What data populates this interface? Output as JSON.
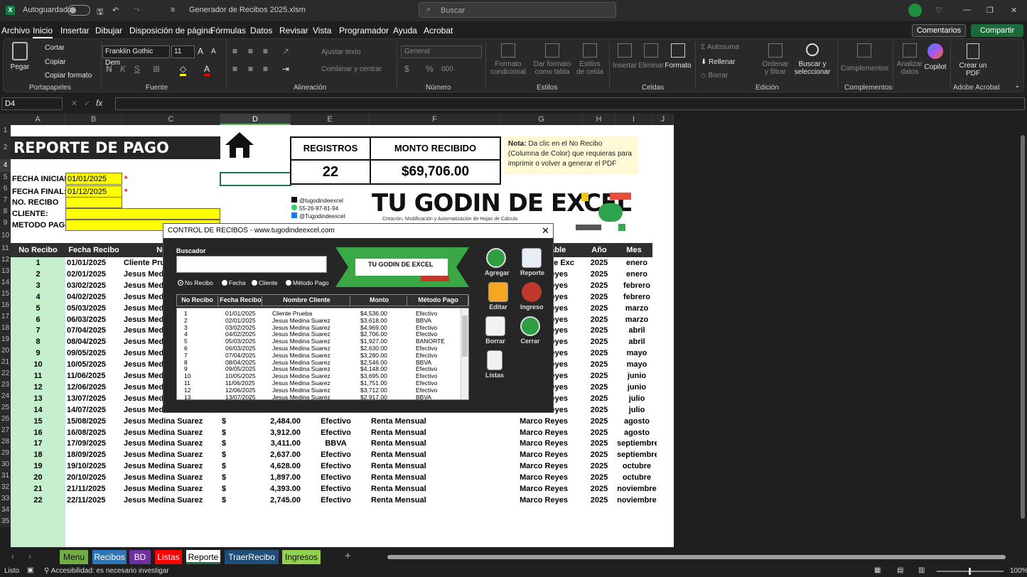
{
  "titlebar": {
    "autosave": "Autoguardado",
    "filename": "Generador de Recibos 2025.xlsm",
    "search": "Buscar"
  },
  "menu": [
    "Archivo",
    "Inicio",
    "Insertar",
    "Dibujar",
    "Disposición de página",
    "Fórmulas",
    "Datos",
    "Revisar",
    "Vista",
    "Programador",
    "Ayuda",
    "Acrobat"
  ],
  "menu_right": {
    "comments": "Comentarios",
    "share": "Compartir"
  },
  "ribbon": {
    "pegar": "Pegar",
    "cortar": "Cortar",
    "copiar": "Copiar",
    "copiar_formato": "Copiar formato",
    "font": "Franklin Gothic Dem",
    "size": "11",
    "ajustar": "Ajustar texto",
    "combinar": "Combinar y centrar",
    "numformat": "General",
    "formato_cond": "Formato condicional",
    "dar_formato": "Dar formato como tabla",
    "estilos_celda": "Estilos de celda",
    "insertar": "Insertar",
    "eliminar": "Eliminar",
    "formato": "Formato",
    "autosuma": "Autosuma",
    "rellenar": "Rellenar",
    "borrar": "Borrar",
    "ordenar": "Ordenar y filtrar",
    "buscar": "Buscar y seleccionar",
    "complementos": "Complementos",
    "analizar": "Analizar datos",
    "copilot": "Copilot",
    "crear_pdf": "Crear un PDF",
    "groups": {
      "portapapeles": "Portapapeles",
      "fuente": "Fuente",
      "alineacion": "Alineación",
      "numero": "Número",
      "estilos": "Estilos",
      "celdas": "Celdas",
      "edicion": "Edición",
      "complementos": "Complementos",
      "acrobat": "Adobe Acrobat"
    }
  },
  "namebox": "D4",
  "fx": "fx",
  "columns": [
    "A",
    "B",
    "C",
    "D",
    "E",
    "F",
    "G",
    "H",
    "I",
    "J"
  ],
  "rows": [
    "1",
    "2",
    "3",
    "4",
    "5",
    "6",
    "7",
    "8",
    "9",
    "10",
    "11",
    "12",
    "13",
    "14",
    "15",
    "16",
    "17",
    "18",
    "19",
    "20",
    "21",
    "22",
    "23",
    "24",
    "25",
    "26",
    "27",
    "28",
    "29",
    "30",
    "31",
    "32",
    "33",
    "34",
    "35"
  ],
  "report": {
    "title": "REPORTE DE PAGO",
    "fecha_inicial_label": "FECHA INICIAL:",
    "fecha_inicial": "01/01/2025",
    "fecha_final_label": "FECHA FINAL:",
    "fecha_final": "01/12/2025",
    "no_recibo_label": "NO. RECIBO",
    "cliente_label": "CLIENTE:",
    "metodo_label": "METODO PAGO:",
    "asterisk": "*",
    "registros_label": "REGISTROS",
    "registros": "22",
    "monto_label": "MONTO RECIBIDO",
    "monto": "$69,706.00",
    "nota_bold": "Nota:",
    "nota": "Da clic en el No Recibo (Columna de Color) que requieras para imprimir o volver a generar el PDF",
    "social": [
      "@tugodindeexcel",
      "55-26-97-81-94",
      "@Tugodindeexcel"
    ],
    "brand": "TU GODIN DE EXCEL",
    "brand_sub": "Creación, Modificación y Automatización de Hojas de Cálculo"
  },
  "table_headers": [
    "No Recibo",
    "Fecha Recibo",
    "Nombre",
    "",
    "",
    "",
    "Responsable",
    "Año",
    "Mes"
  ],
  "table_rows": [
    [
      "1",
      "01/01/2025",
      "Cliente Prueba",
      "",
      "",
      "",
      "Tu Godin de Excel",
      "2025",
      "enero"
    ],
    [
      "2",
      "02/01/2025",
      "Jesus Medina Suarez",
      "",
      "",
      "",
      "Marco Reyes",
      "2025",
      "enero"
    ],
    [
      "3",
      "03/02/2025",
      "Jesus Medina Suarez",
      "",
      "",
      "",
      "Marco Reyes",
      "2025",
      "febrero"
    ],
    [
      "4",
      "04/02/2025",
      "Jesus Medina Suarez",
      "",
      "",
      "",
      "Marco Reyes",
      "2025",
      "febrero"
    ],
    [
      "5",
      "05/03/2025",
      "Jesus Medina Suarez",
      "",
      "",
      "",
      "Marco Reyes",
      "2025",
      "marzo"
    ],
    [
      "6",
      "06/03/2025",
      "Jesus Medina Suarez",
      "",
      "",
      "",
      "Marco Reyes",
      "2025",
      "marzo"
    ],
    [
      "7",
      "07/04/2025",
      "Jesus Medina Suarez",
      "",
      "",
      "",
      "Marco Reyes",
      "2025",
      "abril"
    ],
    [
      "8",
      "08/04/2025",
      "Jesus Medina Suarez",
      "",
      "",
      "",
      "Marco Reyes",
      "2025",
      "abril"
    ],
    [
      "9",
      "09/05/2025",
      "Jesus Medina Suarez",
      "",
      "",
      "",
      "Marco Reyes",
      "2025",
      "mayo"
    ],
    [
      "10",
      "10/05/2025",
      "Jesus Medina Suarez",
      "",
      "",
      "",
      "Marco Reyes",
      "2025",
      "mayo"
    ],
    [
      "11",
      "11/06/2025",
      "Jesus Medina Suarez",
      "",
      "",
      "",
      "Marco Reyes",
      "2025",
      "junio"
    ],
    [
      "12",
      "12/06/2025",
      "Jesus Medina Suarez",
      "",
      "",
      "",
      "Marco Reyes",
      "2025",
      "junio"
    ],
    [
      "13",
      "13/07/2025",
      "Jesus Medina Suarez",
      "",
      "",
      "",
      "Marco Reyes",
      "2025",
      "julio"
    ],
    [
      "14",
      "14/07/2025",
      "Jesus Medina Suarez",
      "",
      "",
      "",
      "Marco Reyes",
      "2025",
      "julio"
    ],
    [
      "15",
      "15/08/2025",
      "Jesus Medina Suarez",
      "$",
      "2,484.00",
      "Efectivo",
      "Renta Mensual",
      "Marco Reyes",
      "2025",
      "agosto"
    ],
    [
      "16",
      "16/08/2025",
      "Jesus Medina Suarez",
      "$",
      "3,912.00",
      "Efectivo",
      "Renta Mensual",
      "Marco Reyes",
      "2025",
      "agosto"
    ],
    [
      "17",
      "17/09/2025",
      "Jesus Medina Suarez",
      "$",
      "3,411.00",
      "BBVA",
      "Renta Mensual",
      "Marco Reyes",
      "2025",
      "septiembre"
    ],
    [
      "18",
      "18/09/2025",
      "Jesus Medina Suarez",
      "$",
      "2,637.00",
      "Efectivo",
      "Renta Mensual",
      "Marco Reyes",
      "2025",
      "septiembre"
    ],
    [
      "19",
      "19/10/2025",
      "Jesus Medina Suarez",
      "$",
      "4,628.00",
      "Efectivo",
      "Renta Mensual",
      "Marco Reyes",
      "2025",
      "octubre"
    ],
    [
      "20",
      "20/10/2025",
      "Jesus Medina Suarez",
      "$",
      "1,897.00",
      "Efectivo",
      "Renta Mensual",
      "Marco Reyes",
      "2025",
      "octubre"
    ],
    [
      "21",
      "21/11/2025",
      "Jesus Medina Suarez",
      "$",
      "4,393.00",
      "Efectivo",
      "Renta Mensual",
      "Marco Reyes",
      "2025",
      "noviembre"
    ],
    [
      "22",
      "22/11/2025",
      "Jesus Medina Suarez",
      "$",
      "2,745.00",
      "Efectivo",
      "Renta Mensual",
      "Marco Reyes",
      "2025",
      "noviembre"
    ]
  ],
  "dialog": {
    "title": "CONTROL DE RECIBOS - www.tugodindeexcel.com",
    "close": "✕",
    "buscador": "Buscador",
    "radios": [
      "No Recibo",
      "Fecha",
      "Cliente",
      "Método Pago"
    ],
    "list_headers": [
      "No Recibo",
      "Fecha Recibo",
      "Nombre Cliente",
      "Monto",
      "Método Pago"
    ],
    "list_rows": [
      [
        "1",
        "01/01/2025",
        "Cliente Prueba",
        "$4,536.00",
        "Efectivo"
      ],
      [
        "2",
        "02/01/2025",
        "Jesus Medina Suarez",
        "$3,618.00",
        "BBVA"
      ],
      [
        "3",
        "03/02/2025",
        "Jesus Medina Suarez",
        "$4,969.00",
        "Efectivo"
      ],
      [
        "4",
        "04/02/2025",
        "Jesus Medina Suarez",
        "$2,706.00",
        "Efectivo"
      ],
      [
        "5",
        "05/03/2025",
        "Jesus Medina Suarez",
        "$1,927.00",
        "BANORTE"
      ],
      [
        "6",
        "06/03/2025",
        "Jesus Medina Suarez",
        "$2,630.00",
        "Efectivo"
      ],
      [
        "7",
        "07/04/2025",
        "Jesus Medina Suarez",
        "$3,280.00",
        "Efectivo"
      ],
      [
        "8",
        "08/04/2025",
        "Jesus Medina Suarez",
        "$2,546.00",
        "BBVA"
      ],
      [
        "9",
        "09/05/2025",
        "Jesus Medina Suarez",
        "$4,148.00",
        "Efectivo"
      ],
      [
        "10",
        "10/05/2025",
        "Jesus Medina Suarez",
        "$3,695.00",
        "Efectivo"
      ],
      [
        "11",
        "11/06/2025",
        "Jesus Medina Suarez",
        "$1,751.00",
        "Efectivo"
      ],
      [
        "12",
        "12/06/2025",
        "Jesus Medina Suarez",
        "$3,712.00",
        "Efectivo"
      ],
      [
        "13",
        "13/07/2025",
        "Jesus Medina Suarez",
        "$2,917.00",
        "BBVA"
      ]
    ],
    "buttons": [
      "Agregar",
      "Reporte",
      "Editar",
      "Ingreso",
      "Borrar",
      "Cerrar",
      "Listas"
    ],
    "banner": "TU GODIN DE EXCEL"
  },
  "sheet_tabs": [
    {
      "label": "Menu",
      "color": "#70ad47"
    },
    {
      "label": "Recibos",
      "color": "#2e75b6"
    },
    {
      "label": "BD",
      "color": "#7030a0"
    },
    {
      "label": "Listas",
      "color": "#ff0000"
    },
    {
      "label": "Reporte",
      "color": "#ffffff"
    },
    {
      "label": "TraerRecibo",
      "color": "#1f4e79"
    },
    {
      "label": "Ingresos",
      "color": "#92d050"
    }
  ],
  "status": {
    "ready": "Listo",
    "accessibility": "Accesibilidad: es necesario investigar",
    "zoom": "100%"
  }
}
